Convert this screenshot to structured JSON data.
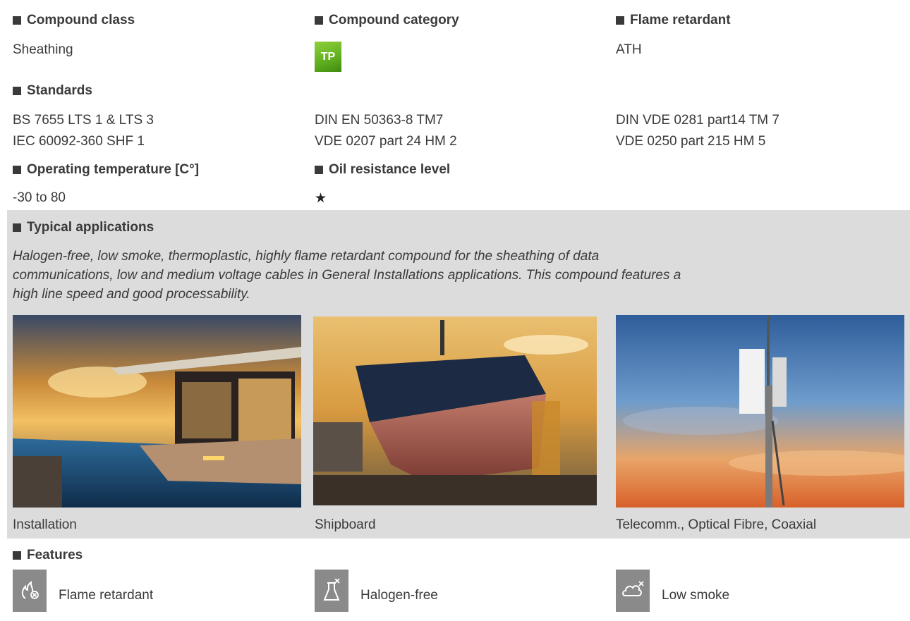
{
  "compound_class": {
    "heading": "Compound class",
    "value": "Sheathing"
  },
  "compound_category": {
    "heading": "Compound category",
    "badge": "TP"
  },
  "flame_retardant": {
    "heading": "Flame retardant",
    "value": "ATH"
  },
  "standards": {
    "heading": "Standards",
    "col1": [
      "BS 7655 LTS 1 & LTS 3",
      "IEC 60092-360 SHF 1"
    ],
    "col2": [
      "DIN EN 50363-8 TM7",
      "VDE 0207 part 24 HM 2"
    ],
    "col3": [
      "DIN VDE 0281 part14 TM 7",
      "VDE 0250 part 215 HM 5"
    ]
  },
  "operating_temperature": {
    "heading": "Operating temperature [C°]",
    "value": "-30 to 80"
  },
  "oil_resistance": {
    "heading": "Oil resistance level",
    "value": "★",
    "level": 1
  },
  "typical_applications": {
    "heading": "Typical applications",
    "lines": [
      "Halogen-free, low smoke, thermoplastic, highly flame retardant compound for the sheathing of data",
      "communications, low and medium voltage cables in General Installations applications. This compound features a",
      "high line speed and good processability."
    ]
  },
  "applications": [
    {
      "caption": "Installation",
      "image": "villa-pool-sunset"
    },
    {
      "caption": "Shipboard",
      "image": "ship-drydock"
    },
    {
      "caption": "Telecomm., Optical Fibre, Coaxial",
      "image": "telecom-mast-sky"
    }
  ],
  "features": {
    "heading": "Features",
    "items": [
      {
        "label": "Flame retardant",
        "icon": "flame-cross-icon"
      },
      {
        "label": "Halogen-free",
        "icon": "flask-cross-icon"
      },
      {
        "label": "Low smoke",
        "icon": "cloud-cross-icon"
      }
    ]
  },
  "colors": {
    "band_grey": "#dcdcdc",
    "badge_green": "#5fae1f",
    "icon_grey": "#8a8a8a"
  }
}
